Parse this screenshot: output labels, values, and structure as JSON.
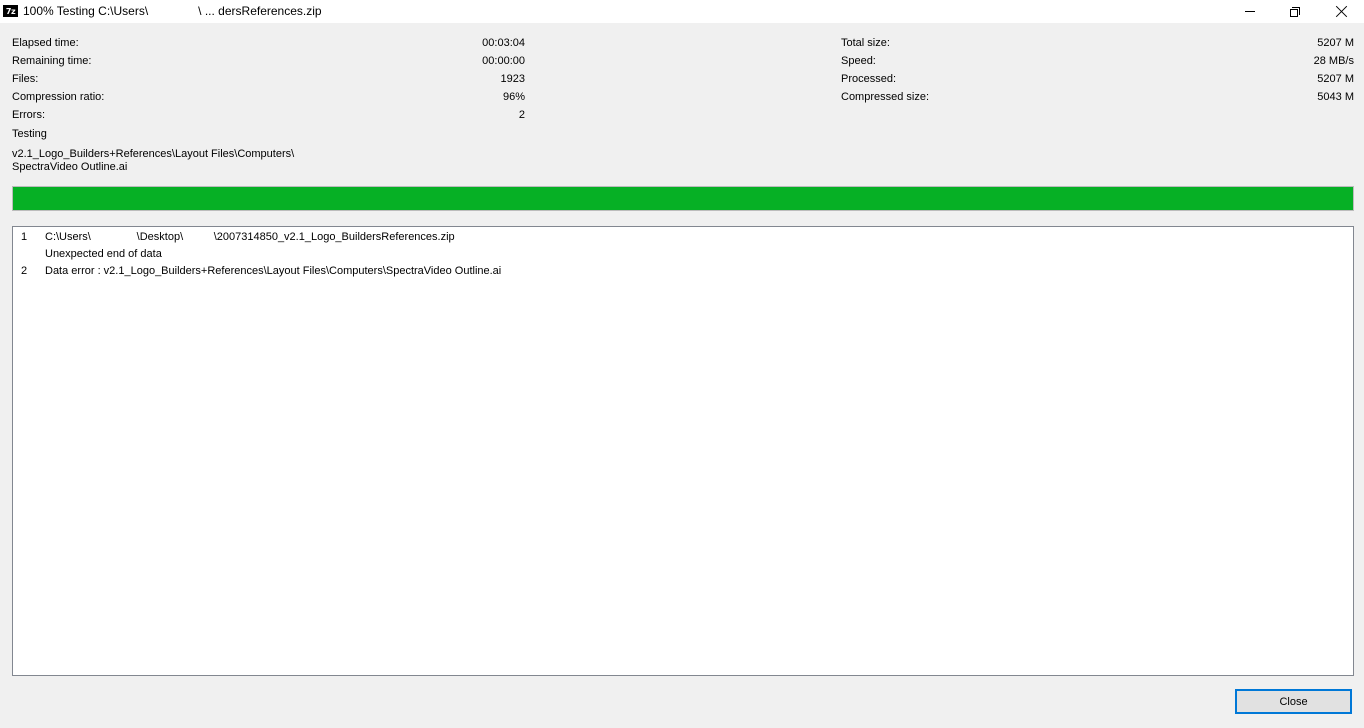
{
  "titlebar": {
    "icon_text": "7z",
    "title": "100% Testing C:\\Users\\               \\ ... dersReferences.zip"
  },
  "stats_left": [
    {
      "label": "Elapsed time:",
      "value": "00:03:04"
    },
    {
      "label": "Remaining time:",
      "value": "00:00:00"
    },
    {
      "label": "Files:",
      "value": "1923"
    },
    {
      "label": "Compression ratio:",
      "value": "96%"
    },
    {
      "label": "Errors:",
      "value": "2"
    }
  ],
  "stats_right": [
    {
      "label": "Total size:",
      "value": "5207 M"
    },
    {
      "label": "Speed:",
      "value": "28 MB/s"
    },
    {
      "label": "Processed:",
      "value": "5207 M"
    },
    {
      "label": "Compressed size:",
      "value": "5043 M"
    }
  ],
  "status": {
    "operation": "Testing",
    "path_line1": "v2.1_Logo_Builders+References\\Layout Files\\Computers\\",
    "path_line2": "SpectraVideo Outline.ai"
  },
  "progress": {
    "percent": 100,
    "color": "#06b025"
  },
  "log": [
    {
      "num": "1",
      "text": "C:\\Users\\               \\Desktop\\          \\2007314850_v2.1_Logo_BuildersReferences.zip"
    },
    {
      "num": "",
      "text": "Unexpected end of data"
    },
    {
      "num": "2",
      "text": "Data error : v2.1_Logo_Builders+References\\Layout Files\\Computers\\SpectraVideo Outline.ai"
    }
  ],
  "buttons": {
    "close_label": "Close"
  },
  "colors": {
    "progress": "#06b025",
    "focus_border": "#0078d7"
  }
}
